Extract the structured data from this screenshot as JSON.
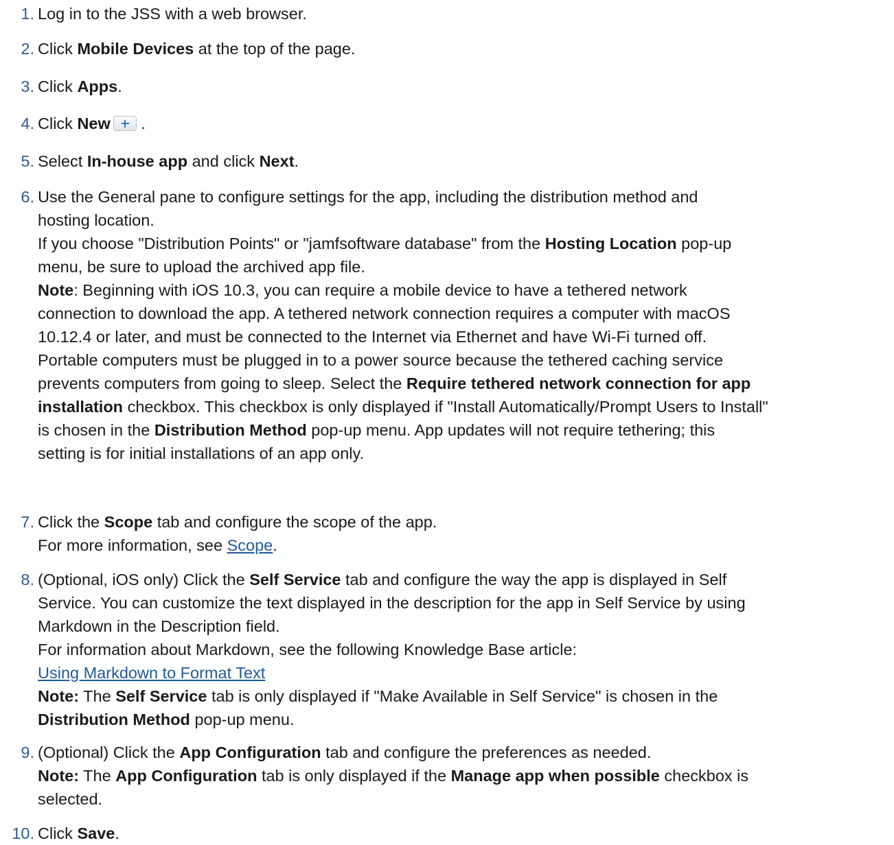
{
  "steps": [
    {
      "num": "1.",
      "text": "Log in to the JSS with a web browser."
    },
    {
      "num": "2.",
      "pre": "Click ",
      "bold": "Mobile Devices",
      "post": " at the top of the page."
    },
    {
      "num": "3.",
      "pre": "Click ",
      "bold": "Apps",
      "post": "."
    },
    {
      "num": "4.",
      "pre": "Click ",
      "bold": "New",
      "post": " .",
      "icon": "plus-button-icon"
    },
    {
      "num": "5.",
      "pre": "Select ",
      "bold": "In-house app",
      "mid": " and click ",
      "bold2": "Next",
      "post": "."
    },
    {
      "num": "6.",
      "line1": "Use the General pane to configure settings for the app, including the distribution method and",
      "line2": "hosting location.",
      "hosting_pre": "If you choose \"Distribution Points\" or \"jamfsoftware database\" from the ",
      "hosting_bold": "Hosting Location",
      "hosting_post": " pop-up",
      "hosting_line2": "menu, be sure to upload the archived app file.",
      "note_label": "Note",
      "note_l1": ": Beginning with iOS 10.3, you can require a mobile device to have a tethered network",
      "note_l2": "connection to download the app. A tethered network connection requires a computer with macOS",
      "note_l3": "10.12.4 or later, and must be connected to the Internet via Ethernet and have Wi-Fi turned off.",
      "note_l4": "Portable computers must be plugged in to a power source because the tethered caching service",
      "note_l5_pre": "prevents computers from going to sleep. Select the ",
      "note_l5_bold": "Require tethered network connection for app",
      "note_l6_bold": "installation",
      "note_l6_post": " checkbox. This checkbox is only displayed if \"Install Automatically/Prompt Users to Install\"",
      "note_l7_pre": "is chosen in the ",
      "note_l7_bold": "Distribution Method",
      "note_l7_post": " pop-up menu. App updates will not require tethering; this",
      "note_l8": "setting is for initial installations of an app only."
    },
    {
      "num": "7.",
      "pre": "Click the ",
      "bold": "Scope",
      "post": " tab and configure the scope of the app.",
      "more_pre": "For more information, see ",
      "more_link": "Scope",
      "more_post": "."
    },
    {
      "num": "8.",
      "l1_pre": "(Optional, iOS only) Click the ",
      "l1_bold": "Self Service",
      "l1_post": " tab and configure the way the app is displayed in Self",
      "l2": "Service. You can customize the text displayed in the description for the app in Self Service by using",
      "l3": "Markdown in the Description field.",
      "l4": "For information about Markdown, see the following Knowledge Base article:",
      "link": "Using Markdown to Format Text",
      "note_label": "Note:",
      "note_mid1": " The ",
      "note_bold1": "Self Service",
      "note_mid2": " tab is only displayed if \"Make Available in Self Service\" is chosen in the",
      "note_bold2": "Distribution Method",
      "note_post": " pop-up menu."
    },
    {
      "num": "9.",
      "pre": "(Optional) Click the ",
      "bold": "App Configuration",
      "post": " tab and configure the preferences as needed.",
      "note_label": "Note:",
      "note_mid1": " The ",
      "note_bold1": "App Configuration",
      "note_mid2": " tab is only displayed if the ",
      "note_bold2": "Manage app when possible",
      "note_post": " checkbox is",
      "note_l2": "selected."
    },
    {
      "num": "10.",
      "pre": "Click ",
      "bold": "Save",
      "post": "."
    }
  ],
  "colors": {
    "number": "#2d5b8e",
    "link": "#1f5a96",
    "text": "#1a1a1a"
  }
}
